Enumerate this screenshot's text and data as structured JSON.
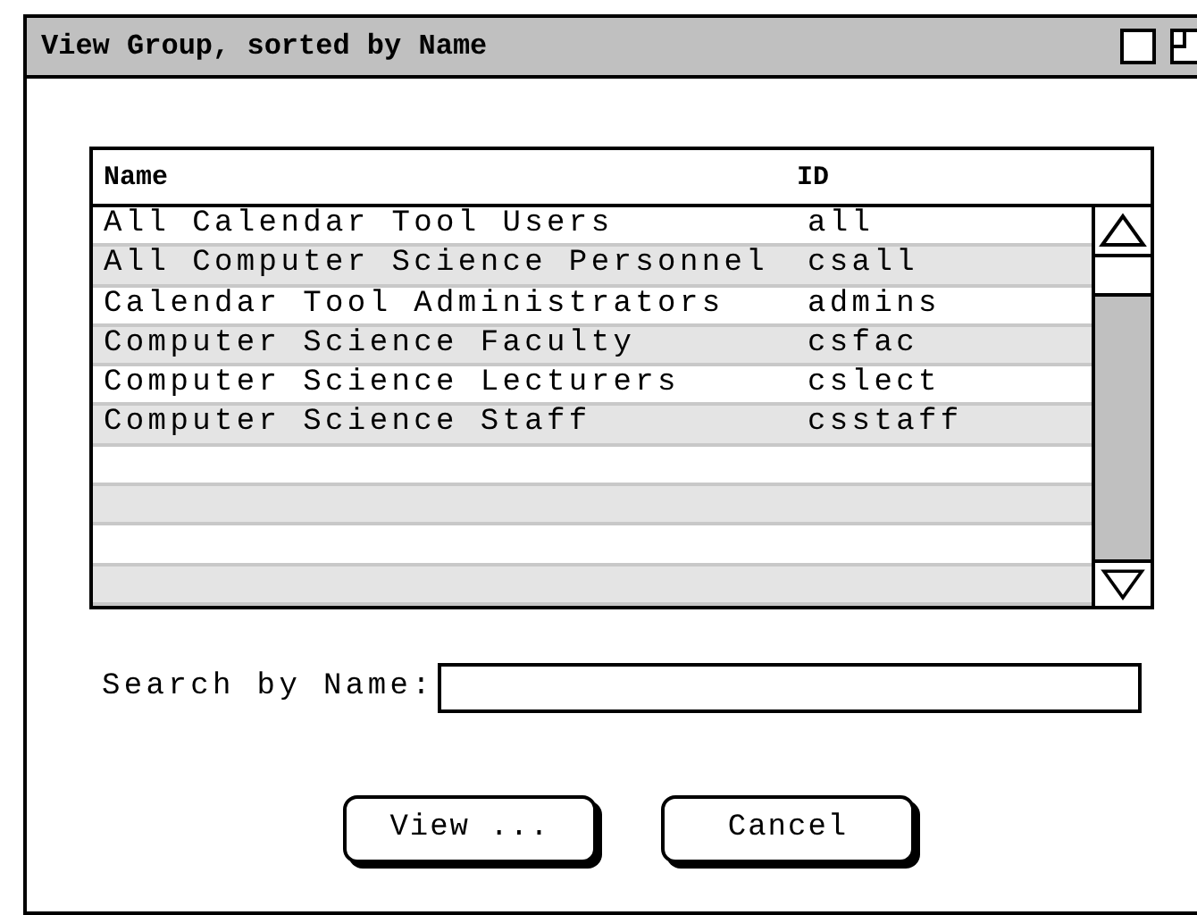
{
  "window": {
    "title": "View Group, sorted by Name"
  },
  "table": {
    "columns": [
      "Name",
      "ID"
    ],
    "rows": [
      {
        "name": "All Calendar Tool Users",
        "id": "all"
      },
      {
        "name": "All Computer Science Personnel",
        "id": "csall"
      },
      {
        "name": "Calendar Tool Administrators",
        "id": "admins"
      },
      {
        "name": "Computer Science Faculty",
        "id": "csfac"
      },
      {
        "name": "Computer Science Lecturers",
        "id": "cslect"
      },
      {
        "name": "Computer Science Staff",
        "id": "csstaff"
      }
    ]
  },
  "search": {
    "label": "Search by Name:"
  },
  "buttons": [
    "View ...",
    "Cancel"
  ]
}
